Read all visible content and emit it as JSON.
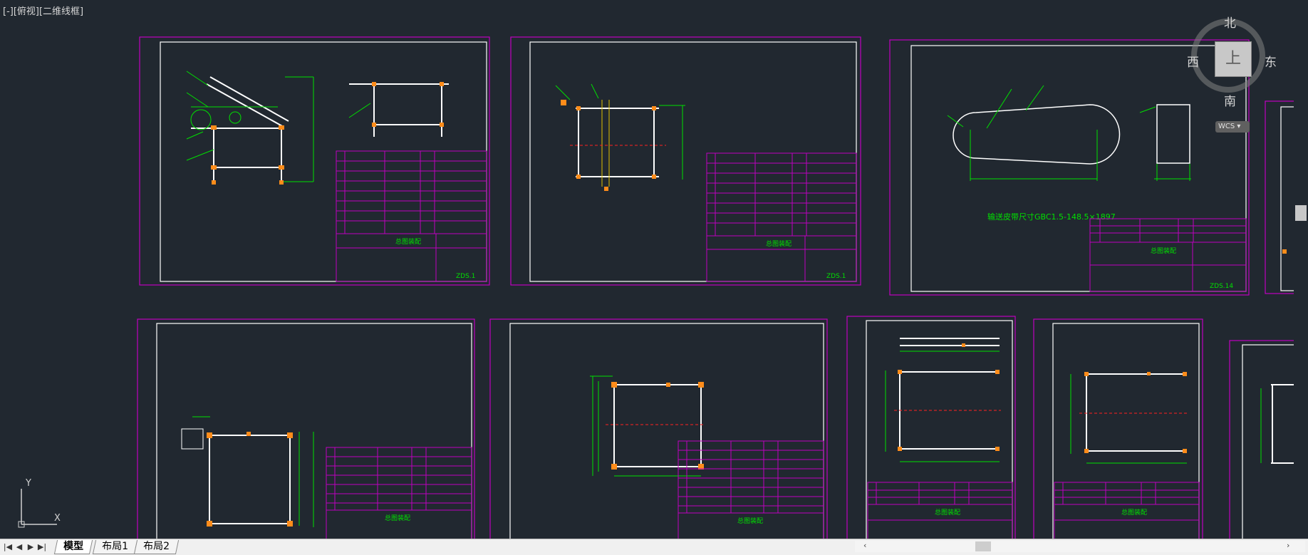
{
  "viewport": {
    "label": "[-][俯视][二维线框]"
  },
  "viewcube": {
    "north": "北",
    "south": "南",
    "east": "东",
    "west": "西",
    "face": "上",
    "wcs": "WCS"
  },
  "ucs": {
    "x_label": "X",
    "y_label": "Y"
  },
  "drawing": {
    "belt_note": "输送皮带尺寸GBC1.5-148.5×1897",
    "title_block_header": "总图装配",
    "sheet_codes": [
      "ZDS.1",
      "ZDS.1",
      "ZDS.14"
    ]
  },
  "tabs": [
    {
      "label": "模型",
      "active": true
    },
    {
      "label": "布局1",
      "active": false
    },
    {
      "label": "布局2",
      "active": false
    }
  ],
  "nav": {
    "first": "|◀",
    "prev": "◀",
    "next": "▶",
    "last": "▶|"
  },
  "colors": {
    "background": "#212830",
    "sheet_border": "#c000c0",
    "geometry": "#00e000",
    "frame": "#ffffff",
    "centerline": "#ff2020"
  }
}
